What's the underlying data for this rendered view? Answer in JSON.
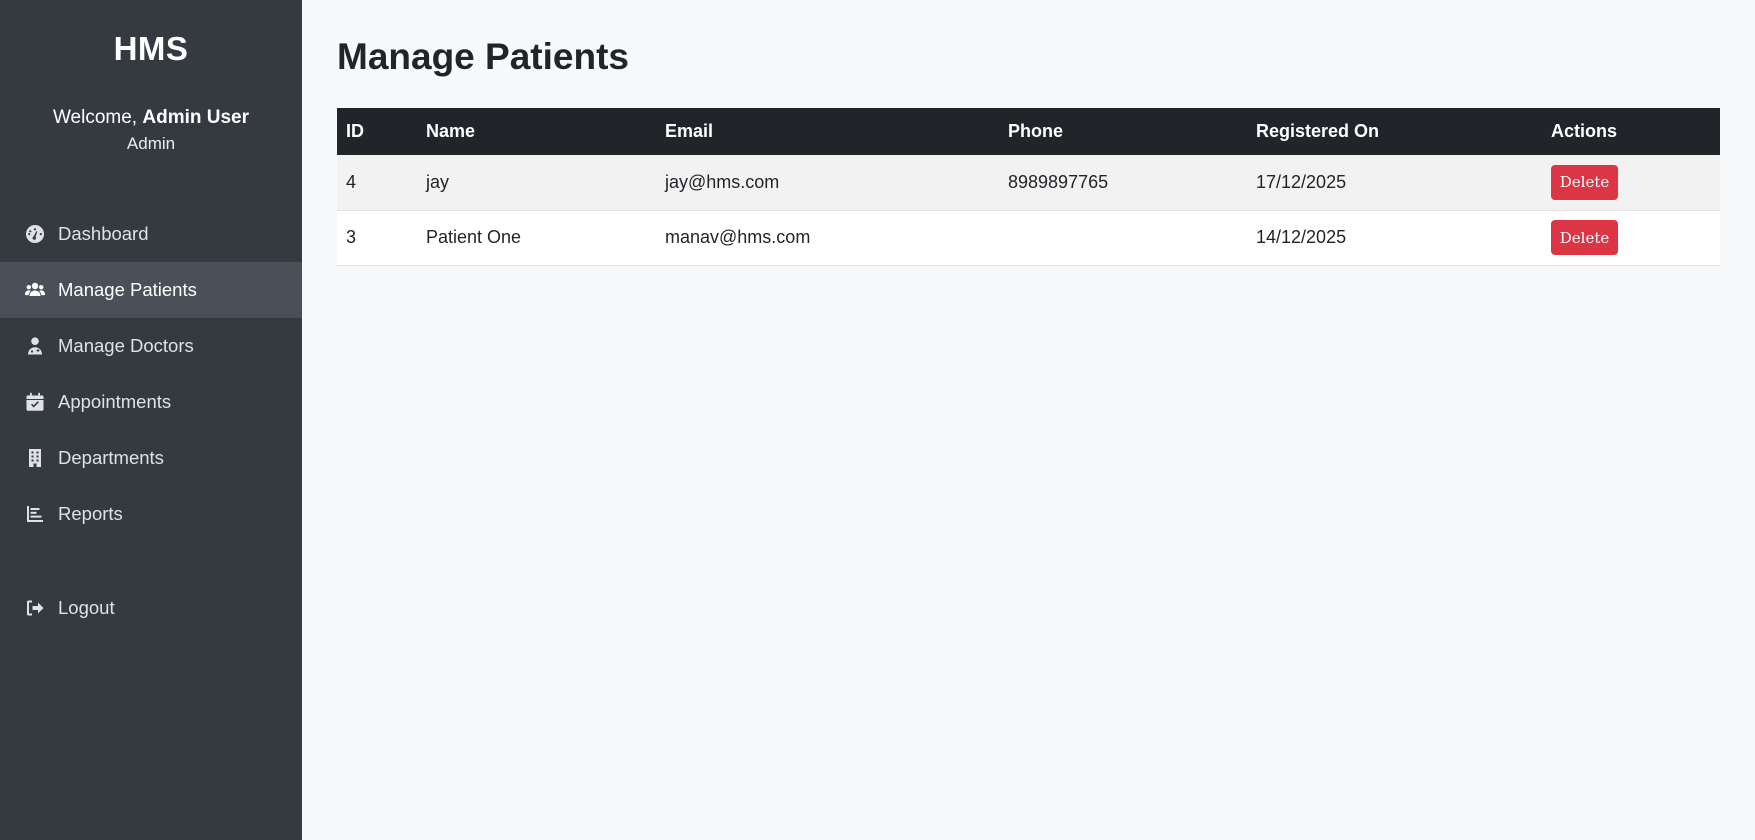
{
  "sidebar": {
    "brand": "HMS",
    "welcome_prefix": "Welcome, ",
    "user_name": "Admin User",
    "role": "Admin",
    "items": [
      {
        "label": "Dashboard",
        "icon": "tachometer-icon"
      },
      {
        "label": "Manage Patients",
        "icon": "users-icon",
        "active": true
      },
      {
        "label": "Manage Doctors",
        "icon": "user-doctor-icon"
      },
      {
        "label": "Appointments",
        "icon": "calendar-check-icon"
      },
      {
        "label": "Departments",
        "icon": "building-icon"
      },
      {
        "label": "Reports",
        "icon": "chart-bar-icon"
      }
    ],
    "logout": {
      "label": "Logout",
      "icon": "sign-out-icon"
    }
  },
  "main": {
    "title": "Manage Patients",
    "table": {
      "headers": [
        "ID",
        "Name",
        "Email",
        "Phone",
        "Registered On",
        "Actions"
      ],
      "rows": [
        {
          "id": "4",
          "name": "jay",
          "email": "jay@hms.com",
          "phone": "8989897765",
          "registered_on": "17/12/2025",
          "action_label": "Delete"
        },
        {
          "id": "3",
          "name": "Patient One",
          "email": "manav@hms.com",
          "phone": "",
          "registered_on": "14/12/2025",
          "action_label": "Delete"
        }
      ]
    }
  },
  "colors": {
    "sidebar_bg": "#343a40",
    "sidebar_active_bg": "#495057",
    "table_header_bg": "#212529",
    "danger": "#dc3545",
    "page_bg": "#f8f9fa"
  }
}
